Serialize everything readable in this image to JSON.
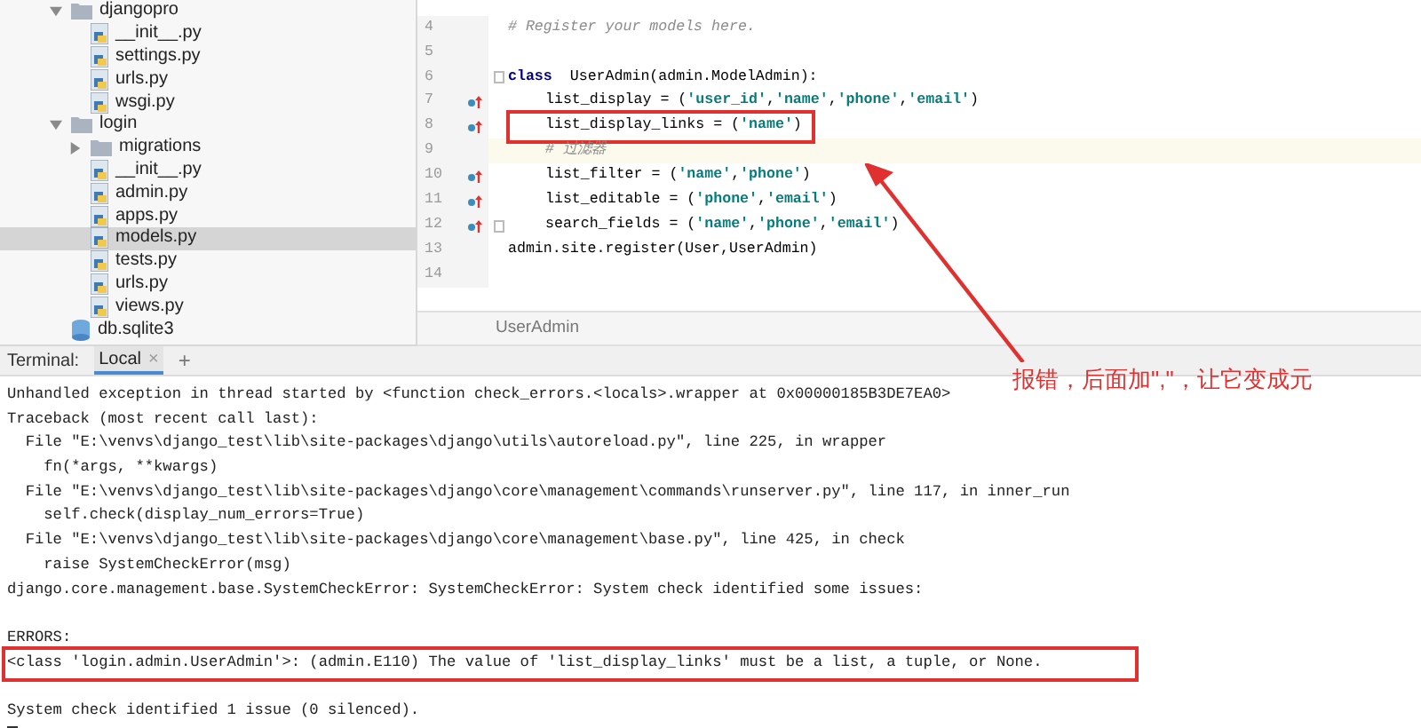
{
  "project_tree": [
    {
      "label": "djangopro",
      "kind": "folder",
      "expanded": true,
      "selected": false,
      "children": [
        {
          "label": "__init__.py",
          "kind": "py",
          "selected": false
        },
        {
          "label": "settings.py",
          "kind": "py",
          "selected": false
        },
        {
          "label": "urls.py",
          "kind": "py",
          "selected": false
        },
        {
          "label": "wsgi.py",
          "kind": "py",
          "selected": false
        }
      ]
    },
    {
      "label": "login",
      "kind": "folder",
      "expanded": true,
      "selected": false,
      "children": [
        {
          "label": "migrations",
          "kind": "folder",
          "expanded": false,
          "selected": false
        },
        {
          "label": "__init__.py",
          "kind": "py",
          "selected": false
        },
        {
          "label": "admin.py",
          "kind": "py",
          "selected": false
        },
        {
          "label": "apps.py",
          "kind": "py",
          "selected": false
        },
        {
          "label": "models.py",
          "kind": "py",
          "selected": true
        },
        {
          "label": "tests.py",
          "kind": "py",
          "selected": false
        },
        {
          "label": "urls.py",
          "kind": "py",
          "selected": false
        },
        {
          "label": "views.py",
          "kind": "py",
          "selected": false
        }
      ]
    },
    {
      "label": "db.sqlite3",
      "kind": "db",
      "selected": false
    }
  ],
  "editor": {
    "lines": [
      {
        "number": "4",
        "marker": false,
        "current": false,
        "fold": false,
        "boxed": false,
        "indented": false,
        "tokens": [
          {
            "kind": "comment",
            "text": "# Register your models here."
          }
        ]
      },
      {
        "number": "5",
        "marker": false,
        "current": false,
        "fold": false,
        "boxed": false
      },
      {
        "number": "6",
        "marker": false,
        "current": false,
        "fold": true,
        "boxed": false,
        "indented": false,
        "tokens": [
          {
            "kind": "keyword",
            "text": "class"
          },
          {
            "kind": "plain",
            "text": "  UserAdmin(admin.ModelAdmin):"
          }
        ]
      },
      {
        "number": "7",
        "marker": true,
        "current": false,
        "fold": false,
        "boxed": false,
        "indented": true,
        "tokens": [
          {
            "kind": "plain",
            "text": "list_display = ("
          },
          {
            "kind": "string",
            "text": "'user_id'"
          },
          {
            "kind": "plain",
            "text": ","
          },
          {
            "kind": "string",
            "text": "'name'"
          },
          {
            "kind": "plain",
            "text": ","
          },
          {
            "kind": "string",
            "text": "'phone'"
          },
          {
            "kind": "plain",
            "text": ","
          },
          {
            "kind": "string",
            "text": "'email'"
          },
          {
            "kind": "plain",
            "text": ")"
          }
        ]
      },
      {
        "number": "8",
        "marker": true,
        "current": false,
        "fold": false,
        "boxed": true,
        "indented": true,
        "tokens": [
          {
            "kind": "plain",
            "text": "list_display_links = ("
          },
          {
            "kind": "string",
            "text": "'name'"
          },
          {
            "kind": "plain",
            "text": ")"
          }
        ]
      },
      {
        "number": "9",
        "marker": false,
        "current": true,
        "fold": false,
        "boxed": false,
        "indented": true,
        "tokens": [
          {
            "kind": "comment",
            "text": "# 过滤器"
          }
        ]
      },
      {
        "number": "10",
        "marker": true,
        "current": false,
        "fold": false,
        "boxed": false,
        "indented": true,
        "tokens": [
          {
            "kind": "plain",
            "text": "list_filter = ("
          },
          {
            "kind": "string",
            "text": "'name'"
          },
          {
            "kind": "plain",
            "text": ","
          },
          {
            "kind": "string",
            "text": "'phone'"
          },
          {
            "kind": "plain",
            "text": ")"
          }
        ]
      },
      {
        "number": "11",
        "marker": true,
        "current": false,
        "fold": false,
        "boxed": false,
        "indented": true,
        "tokens": [
          {
            "kind": "plain",
            "text": "list_editable = ("
          },
          {
            "kind": "string",
            "text": "'phone'"
          },
          {
            "kind": "plain",
            "text": ","
          },
          {
            "kind": "string",
            "text": "'email'"
          },
          {
            "kind": "plain",
            "text": ")"
          }
        ]
      },
      {
        "number": "12",
        "marker": true,
        "current": false,
        "fold": true,
        "boxed": false,
        "indented": true,
        "tokens": [
          {
            "kind": "plain",
            "text": "search_fields = ("
          },
          {
            "kind": "string",
            "text": "'name'"
          },
          {
            "kind": "plain",
            "text": ","
          },
          {
            "kind": "string",
            "text": "'phone'"
          },
          {
            "kind": "plain",
            "text": ","
          },
          {
            "kind": "string",
            "text": "'email'"
          },
          {
            "kind": "plain",
            "text": ")"
          }
        ]
      },
      {
        "number": "13",
        "marker": false,
        "current": false,
        "fold": false,
        "boxed": false,
        "indented": false,
        "tokens": [
          {
            "kind": "plain",
            "text": "admin.site.register(User,UserAdmin)"
          }
        ]
      },
      {
        "number": "14",
        "marker": false,
        "current": false,
        "fold": false,
        "boxed": false
      }
    ],
    "breadcrumb": "UserAdmin"
  },
  "terminal": {
    "label": "Terminal:",
    "tabs": [
      {
        "label": "Local",
        "selected": true,
        "close": "×"
      }
    ],
    "new_tab": "+",
    "lines": [
      {
        "text": "Unhandled exception in thread started by <function check_errors.<locals>.wrapper at 0x00000185B3DE7EA0>",
        "boxed": false
      },
      {
        "text": "Traceback (most recent call last):",
        "boxed": false
      },
      {
        "text": "  File \"E:\\venvs\\django_test\\lib\\site-packages\\django\\utils\\autoreload.py\", line 225, in wrapper",
        "boxed": false
      },
      {
        "text": "    fn(*args, **kwargs)",
        "boxed": false
      },
      {
        "text": "  File \"E:\\venvs\\django_test\\lib\\site-packages\\django\\core\\management\\commands\\runserver.py\", line 117, in inner_run",
        "boxed": false
      },
      {
        "text": "    self.check(display_num_errors=True)",
        "boxed": false
      },
      {
        "text": "  File \"E:\\venvs\\django_test\\lib\\site-packages\\django\\core\\management\\base.py\", line 425, in check",
        "boxed": false
      },
      {
        "text": "    raise SystemCheckError(msg)",
        "boxed": false
      },
      {
        "text": "django.core.management.base.SystemCheckError: SystemCheckError: System check identified some issues:",
        "boxed": false
      },
      {
        "text": "ERRORS:",
        "boxed": false,
        "gap_before": true
      },
      {
        "text": "<class 'login.admin.UserAdmin'>: (admin.E110) The value of 'list_display_links' must be a list, a tuple, or None.",
        "boxed": true
      },
      {
        "text": "System check identified 1 issue (0 silenced).",
        "boxed": false,
        "gap_before": true
      }
    ]
  },
  "annotation": {
    "text": "报错，后面加\",\"，让它变成元"
  }
}
